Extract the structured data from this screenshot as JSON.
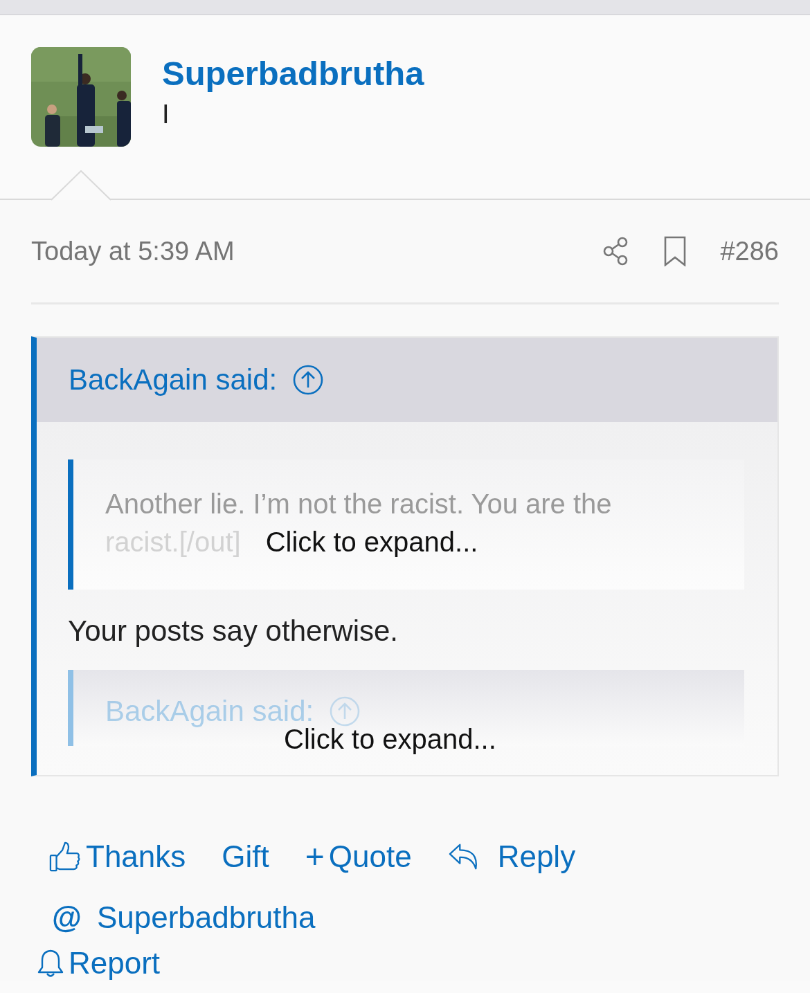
{
  "post": {
    "author": "Superbadbrutha",
    "first_line": "I",
    "time": "Today at 5:39 AM",
    "number": "#286"
  },
  "quote": {
    "attribution": "BackAgain said:",
    "blocks": [
      {
        "kind": "quote",
        "lines": [
          "Another lie. I’m not the racist. You are the",
          "racist.[/out]"
        ],
        "expand": "Click to expand..."
      },
      {
        "kind": "text",
        "text": "Your posts say otherwise."
      },
      {
        "kind": "quote_header",
        "attribution": "BackAgain said:",
        "expand": "Click to expand..."
      }
    ]
  },
  "actions": [
    {
      "kind": "thanks",
      "label": "Thanks"
    },
    {
      "kind": "plain",
      "label": "Gift"
    },
    {
      "kind": "quote",
      "icon": "+",
      "label": "Quote"
    },
    {
      "kind": "reply",
      "label": "Reply"
    }
  ],
  "mention": {
    "icon": "@",
    "label": "Superbadbrutha"
  },
  "report": {
    "label": "Report"
  }
}
